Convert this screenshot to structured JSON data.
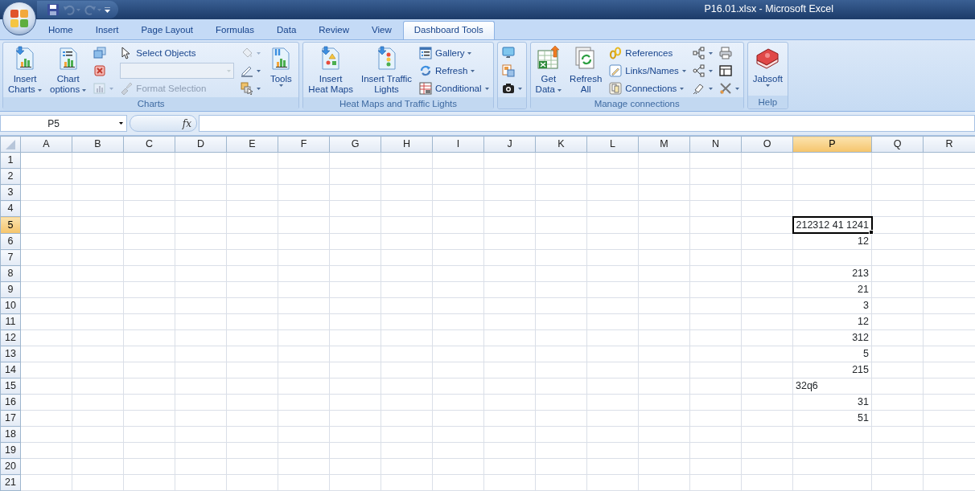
{
  "window": {
    "title": "P16.01.xlsx - Microsoft Excel"
  },
  "quick_access": [
    {
      "kind": "save",
      "disabled": false,
      "dropdown": false
    },
    {
      "kind": "undo",
      "disabled": true,
      "dropdown": true
    },
    {
      "kind": "redo",
      "disabled": true,
      "dropdown": true
    }
  ],
  "tabs": [
    {
      "label": "Home",
      "selected": false
    },
    {
      "label": "Insert",
      "selected": false
    },
    {
      "label": "Page Layout",
      "selected": false
    },
    {
      "label": "Formulas",
      "selected": false
    },
    {
      "label": "Data",
      "selected": false
    },
    {
      "label": "Review",
      "selected": false
    },
    {
      "label": "View",
      "selected": false
    },
    {
      "label": "Dashboard Tools",
      "selected": true
    }
  ],
  "ribbon": [
    {
      "label": "Charts",
      "items": [
        {
          "kind": "large",
          "lines": [
            "Insert",
            "Charts"
          ],
          "dropdown": true,
          "disabled": false
        },
        {
          "kind": "large",
          "lines": [
            "Chart",
            "options"
          ],
          "dropdown": true,
          "disabled": false
        },
        {
          "kind": "icon",
          "dropdown": false,
          "disabled": false
        },
        {
          "kind": "icon",
          "dropdown": false,
          "disabled": false
        },
        {
          "kind": "icon",
          "dropdown": true,
          "disabled": true
        },
        {
          "kind": "small",
          "label": "Select Objects",
          "dropdown": false,
          "disabled": false
        },
        {
          "kind": "combo",
          "dropdown": true,
          "disabled": true
        },
        {
          "kind": "small",
          "label": "Format Selection",
          "dropdown": false,
          "disabled": true
        },
        {
          "kind": "icon",
          "dropdown": true,
          "disabled": true
        },
        {
          "kind": "icon",
          "dropdown": true,
          "disabled": false
        },
        {
          "kind": "icon",
          "dropdown": true,
          "disabled": false
        },
        {
          "kind": "large",
          "lines": [
            "Tools"
          ],
          "dropdown": true,
          "disabled": false
        }
      ]
    },
    {
      "label": "Heat Maps and Traffic Lights",
      "items": [
        {
          "kind": "large",
          "lines": [
            "Insert",
            "Heat Maps"
          ],
          "dropdown": false,
          "disabled": false
        },
        {
          "kind": "large",
          "lines": [
            "Insert Traffic",
            "Lights"
          ],
          "dropdown": false,
          "disabled": false
        },
        {
          "kind": "small",
          "label": "Gallery",
          "dropdown": true,
          "disabled": false
        },
        {
          "kind": "small",
          "label": "Refresh",
          "dropdown": true,
          "disabled": false
        },
        {
          "kind": "small",
          "label": "Conditional",
          "dropdown": true,
          "disabled": false
        }
      ]
    },
    {
      "items": [
        {
          "kind": "icon",
          "dropdown": false,
          "disabled": false
        },
        {
          "kind": "icon",
          "dropdown": false,
          "disabled": false
        },
        {
          "kind": "icon",
          "dropdown": true,
          "disabled": false
        }
      ]
    },
    {
      "label": "Manage connections",
      "items": [
        {
          "kind": "large",
          "lines": [
            "Get",
            "Data"
          ],
          "dropdown": true,
          "disabled": false
        },
        {
          "kind": "large",
          "lines": [
            "Refresh",
            "All"
          ],
          "dropdown": false,
          "disabled": false
        },
        {
          "kind": "small",
          "label": "References",
          "dropdown": false,
          "disabled": false
        },
        {
          "kind": "small",
          "label": "Links/Names",
          "dropdown": true,
          "disabled": false
        },
        {
          "kind": "small",
          "label": "Connections",
          "dropdown": true,
          "disabled": false
        },
        {
          "kind": "icon",
          "dropdown": true,
          "disabled": false
        },
        {
          "kind": "icon",
          "dropdown": true,
          "disabled": false
        },
        {
          "kind": "icon",
          "dropdown": true,
          "disabled": false
        },
        {
          "kind": "icon",
          "dropdown": false,
          "disabled": false
        },
        {
          "kind": "icon",
          "dropdown": false,
          "disabled": false
        },
        {
          "kind": "icon",
          "dropdown": true,
          "disabled": false
        }
      ]
    },
    {
      "label": "Help",
      "items": [
        {
          "kind": "large",
          "lines": [
            "Jabsoft"
          ],
          "dropdown": true,
          "disabled": false
        }
      ]
    }
  ],
  "formula_bar": {
    "name_box": "P5",
    "function_button": "fx"
  },
  "sheet": {
    "columns": [
      {
        "label": "A",
        "selected": false
      },
      {
        "label": "B",
        "selected": false
      },
      {
        "label": "C",
        "selected": false
      },
      {
        "label": "D",
        "selected": false
      },
      {
        "label": "E",
        "selected": false
      },
      {
        "label": "F",
        "selected": false
      },
      {
        "label": "G",
        "selected": false
      },
      {
        "label": "H",
        "selected": false
      },
      {
        "label": "I",
        "selected": false
      },
      {
        "label": "J",
        "selected": false
      },
      {
        "label": "K",
        "selected": false
      },
      {
        "label": "L",
        "selected": false
      },
      {
        "label": "M",
        "selected": false
      },
      {
        "label": "N",
        "selected": false
      },
      {
        "label": "O",
        "selected": false
      },
      {
        "label": "P",
        "selected": true
      },
      {
        "label": "Q",
        "selected": false
      },
      {
        "label": "R",
        "selected": false
      }
    ],
    "rows": [
      {
        "label": "1",
        "selected": false
      },
      {
        "label": "2",
        "selected": false
      },
      {
        "label": "3",
        "selected": false
      },
      {
        "label": "4",
        "selected": false
      },
      {
        "label": "5",
        "selected": true,
        "cell_p": {
          "text": "212312 41 1241",
          "kind": "text",
          "selected": true
        }
      },
      {
        "label": "6",
        "selected": false,
        "cell_p": {
          "text": "12",
          "kind": "number",
          "selected": false
        }
      },
      {
        "label": "7",
        "selected": false
      },
      {
        "label": "8",
        "selected": false,
        "cell_p": {
          "text": "213",
          "kind": "number",
          "selected": false
        }
      },
      {
        "label": "9",
        "selected": false,
        "cell_p": {
          "text": "21",
          "kind": "number",
          "selected": false
        }
      },
      {
        "label": "10",
        "selected": false,
        "cell_p": {
          "text": "3",
          "kind": "number",
          "selected": false
        }
      },
      {
        "label": "11",
        "selected": false,
        "cell_p": {
          "text": "12",
          "kind": "number",
          "selected": false
        }
      },
      {
        "label": "12",
        "selected": false,
        "cell_p": {
          "text": "312",
          "kind": "number",
          "selected": false
        }
      },
      {
        "label": "13",
        "selected": false,
        "cell_p": {
          "text": "5",
          "kind": "number",
          "selected": false
        }
      },
      {
        "label": "14",
        "selected": false,
        "cell_p": {
          "text": "215",
          "kind": "number",
          "selected": false
        }
      },
      {
        "label": "15",
        "selected": false,
        "cell_p": {
          "text": "32q6",
          "kind": "text",
          "selected": false
        }
      },
      {
        "label": "16",
        "selected": false,
        "cell_p": {
          "text": "31",
          "kind": "number",
          "selected": false
        }
      },
      {
        "label": "17",
        "selected": false,
        "cell_p": {
          "text": "51",
          "kind": "number",
          "selected": false
        }
      },
      {
        "label": "18",
        "selected": false
      },
      {
        "label": "19",
        "selected": false
      },
      {
        "label": "20",
        "selected": false
      },
      {
        "label": "21",
        "selected": false
      }
    ]
  }
}
